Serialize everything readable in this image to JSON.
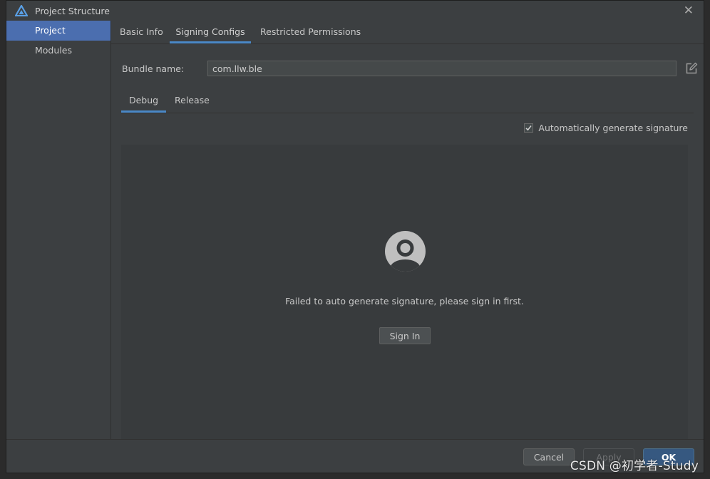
{
  "window": {
    "title": "Project Structure",
    "app_icon": "harmony-logo-icon",
    "close_icon": "close-icon"
  },
  "sidebar": {
    "items": [
      {
        "label": "Project",
        "active": true
      },
      {
        "label": "Modules",
        "active": false
      }
    ]
  },
  "tabs": [
    {
      "label": "Basic Info",
      "active": false
    },
    {
      "label": "Signing Configs",
      "active": true
    },
    {
      "label": "Restricted Permissions",
      "active": false
    }
  ],
  "bundle": {
    "label": "Bundle name:",
    "value": "com.llw.ble",
    "edit_icon": "edit-icon"
  },
  "subtabs": [
    {
      "label": "Debug",
      "active": true
    },
    {
      "label": "Release",
      "active": false
    }
  ],
  "auto_signature": {
    "label": "Automatically generate signature",
    "checked": true
  },
  "signin_panel": {
    "avatar_icon": "user-avatar-icon",
    "message": "Failed to auto generate signature, please sign in first.",
    "button_label": "Sign In"
  },
  "footer": {
    "cancel_label": "Cancel",
    "apply_label": "Apply",
    "ok_label": "OK"
  },
  "watermark": "CSDN @初学者-Study",
  "colors": {
    "accent": "#4a88c7",
    "selection": "#4b6eaf",
    "background": "#3c3f41"
  }
}
